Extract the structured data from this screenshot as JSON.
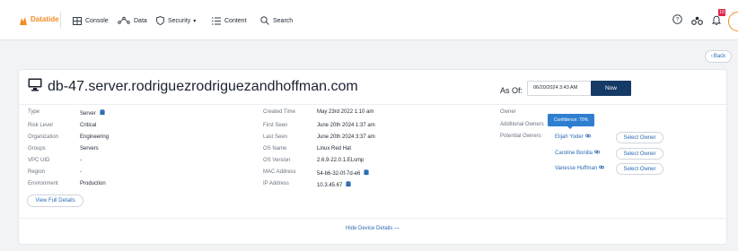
{
  "nav": {
    "logo_text": "Datatide",
    "items": [
      {
        "label": "Console",
        "icon": "console-icon"
      },
      {
        "label": "Data",
        "icon": "data-icon"
      },
      {
        "label": "Security",
        "icon": "shield-icon",
        "has_caret": true
      },
      {
        "label": "Content",
        "icon": "list-icon"
      },
      {
        "label": "Search",
        "icon": "search-icon"
      }
    ],
    "notification_count": "10",
    "accent_color": "#f28c28"
  },
  "back_label": "Back",
  "device": {
    "title": "db-47.server.rodriguezrodriguezandhoffman.com",
    "as_of_label": "As Of:",
    "as_of_value": "06/20/2024 3:43 AM",
    "now_label": "Now",
    "left_fields": [
      {
        "label": "Type",
        "value": "Server",
        "icon": "database-icon"
      },
      {
        "label": "Risk Level",
        "value": "Critical"
      },
      {
        "label": "Organization",
        "value": "Engineering"
      },
      {
        "label": "Groups",
        "value": "Servers"
      },
      {
        "label": "VPC UID",
        "value": "-"
      },
      {
        "label": "Region",
        "value": "-"
      },
      {
        "label": "Environment",
        "value": "Production"
      }
    ],
    "middle_fields": [
      {
        "label": "Created Time",
        "value": "May 23rd 2022 1:10 am"
      },
      {
        "label": "First Seen",
        "value": "June 20th 2024 1:37 am"
      },
      {
        "label": "Last Seen",
        "value": "June 20th 2024 3:37 am"
      },
      {
        "label": "OS Name",
        "value": "Linux Red Hat"
      },
      {
        "label": "OS Version",
        "value": "2.6.9-22.0.1.ELsmp"
      },
      {
        "label": "MAC Address",
        "value": "54-b6-32-0f-7d-e6",
        "icon": "database-icon"
      },
      {
        "label": "IP Address",
        "value": "10.3.45.67",
        "icon": "database-icon"
      }
    ],
    "right_labels": {
      "owner": "Owner",
      "additional_owners": "Additional Owners",
      "potential_owners": "Potential Owners"
    },
    "tooltip": "Confidence: 70%",
    "potential_owners": [
      {
        "name": "Elijah Yoder"
      },
      {
        "name": "Caroline Bonilla"
      },
      {
        "name": "Vanesse Huffman"
      }
    ],
    "select_owner_label": "Select Owner",
    "view_full_details": "View Full Details",
    "hide_details": "Hide Device Details"
  }
}
